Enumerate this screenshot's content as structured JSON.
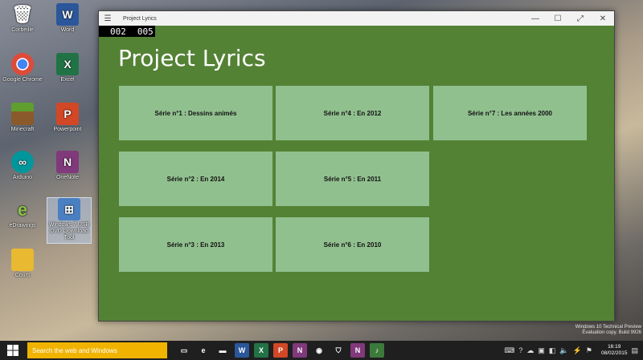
{
  "desktop": {
    "icons": [
      {
        "label": "Corbeille",
        "glyph": "🗑",
        "color": "#6a8fb8"
      },
      {
        "label": "Word",
        "glyph": "W",
        "color": "#2b579a"
      },
      {
        "label": "Google Chrome",
        "glyph": "◉",
        "color": "#dd4b39"
      },
      {
        "label": "Excel",
        "glyph": "X",
        "color": "#217346"
      },
      {
        "label": "Minecraft",
        "glyph": "▦",
        "color": "#6b8e23"
      },
      {
        "label": "Powerpoint",
        "glyph": "P",
        "color": "#d24726"
      },
      {
        "label": "Arduino",
        "glyph": "∞",
        "color": "#00979c"
      },
      {
        "label": "OneNote",
        "glyph": "N",
        "color": "#80397b"
      },
      {
        "label": "eDrawings",
        "glyph": "e",
        "color": "#7cb342"
      },
      {
        "label": "Windows 7 USB DVD Download Tool",
        "glyph": "⊞",
        "color": "#4a7fc1"
      },
      {
        "label": "Cours",
        "glyph": "📁",
        "color": "#e8b931"
      }
    ]
  },
  "window": {
    "title": "Project Lyrics",
    "counter_left": "002",
    "counter_right": "005",
    "app_title": "Project Lyrics",
    "tiles": [
      {
        "label": "Série n°1 : Dessins animés"
      },
      {
        "label": "Série n°4 : En 2012"
      },
      {
        "label": "Série n°7 : Les années 2000"
      },
      {
        "label": "Série n°2 : En 2014"
      },
      {
        "label": "Série n°5 : En 2011"
      },
      {
        "label": "Série n°3 : En 2013"
      },
      {
        "label": "Série n°6 : En 2010"
      }
    ]
  },
  "watermark": {
    "line1": "Windows 10 Technical Preview",
    "line2": "Évaluation copy. Build 9926"
  },
  "taskbar": {
    "search_placeholder": "Search the web and Windows",
    "apps": [
      {
        "name": "task-view-icon",
        "glyph": "▭",
        "color": "#1f1f1f"
      },
      {
        "name": "internet-explorer-icon",
        "glyph": "e",
        "color": "#1f1f1f"
      },
      {
        "name": "file-explorer-icon",
        "glyph": "▬",
        "color": "#1f1f1f"
      },
      {
        "name": "word-icon",
        "glyph": "W",
        "color": "#2b579a"
      },
      {
        "name": "excel-icon",
        "glyph": "X",
        "color": "#217346"
      },
      {
        "name": "powerpoint-icon",
        "glyph": "P",
        "color": "#d24726"
      },
      {
        "name": "onenote-icon",
        "glyph": "N",
        "color": "#80397b"
      },
      {
        "name": "chrome-icon",
        "glyph": "◉",
        "color": "#1f1f1f"
      },
      {
        "name": "store-icon",
        "glyph": "⛉",
        "color": "#1f1f1f"
      },
      {
        "name": "onenote-2-icon",
        "glyph": "N",
        "color": "#80397b"
      },
      {
        "name": "project-lyrics-icon",
        "glyph": "♪",
        "color": "#3b7a3b"
      }
    ],
    "clock_time": "16:19",
    "clock_date": "08/02/2015"
  }
}
